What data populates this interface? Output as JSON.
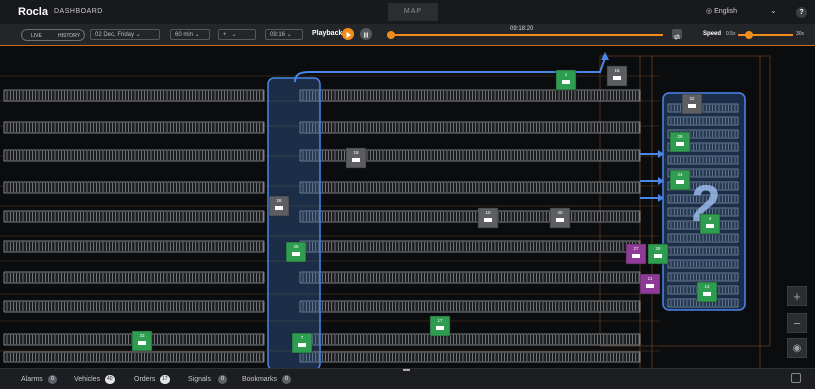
{
  "header": {
    "logo": "Rocla",
    "nav_label": "DASHBOARD",
    "center_tab": "MAP",
    "language": "English",
    "help_label": "?"
  },
  "controls": {
    "mode_live": "LIVE",
    "mode_history": "HISTORY",
    "date": "02 Dec, Friday",
    "duration": "60 min",
    "plus": "+",
    "time": "09:16",
    "playback_label": "Playback",
    "timeline_time": "09:18:20",
    "speed_label": "Speed",
    "speed_min": "0.5x",
    "speed_max": "30x",
    "playback_progress": 0.0,
    "speed_level": 0.12
  },
  "colors": {
    "accent": "#f28c1b",
    "vehicle_green": "#2e9d4f",
    "vehicle_gray": "#5c5e62",
    "vehicle_purple": "#8e3a97",
    "zone_blue": "#3c6fb3",
    "route_blue": "#4a86e8"
  },
  "map": {
    "vehicles": [
      {
        "id": "1",
        "color": "green"
      },
      {
        "id": "16",
        "color": "gray"
      },
      {
        "id": "22",
        "color": "gray"
      },
      {
        "id": "29",
        "color": "green"
      },
      {
        "id": "18",
        "color": "gray"
      },
      {
        "id": "24",
        "color": "green"
      },
      {
        "id": "26",
        "color": "gray"
      },
      {
        "id": "10",
        "color": "gray"
      },
      {
        "id": "40",
        "color": "gray"
      },
      {
        "id": "4",
        "color": "green"
      },
      {
        "id": "25",
        "color": "green"
      },
      {
        "id": "27",
        "color": "purple"
      },
      {
        "id": "28",
        "color": "green"
      },
      {
        "id": "11",
        "color": "purple"
      },
      {
        "id": "14",
        "color": "green"
      },
      {
        "id": "17",
        "color": "green"
      },
      {
        "id": "33",
        "color": "green"
      },
      {
        "id": "7",
        "color": "green"
      }
    ],
    "zone_label": "2",
    "zoom_in": "+",
    "zoom_out": "−",
    "recenter": "◉"
  },
  "bottom": {
    "alarms_label": "Alarms",
    "alarms_count": "0",
    "vehicles_label": "Vehicles",
    "vehicles_count": "40",
    "orders_label": "Orders",
    "orders_count": "17",
    "signals_label": "Signals",
    "signals_count": "0",
    "bookmarks_label": "Bookmarks",
    "bookmarks_count": "0"
  }
}
